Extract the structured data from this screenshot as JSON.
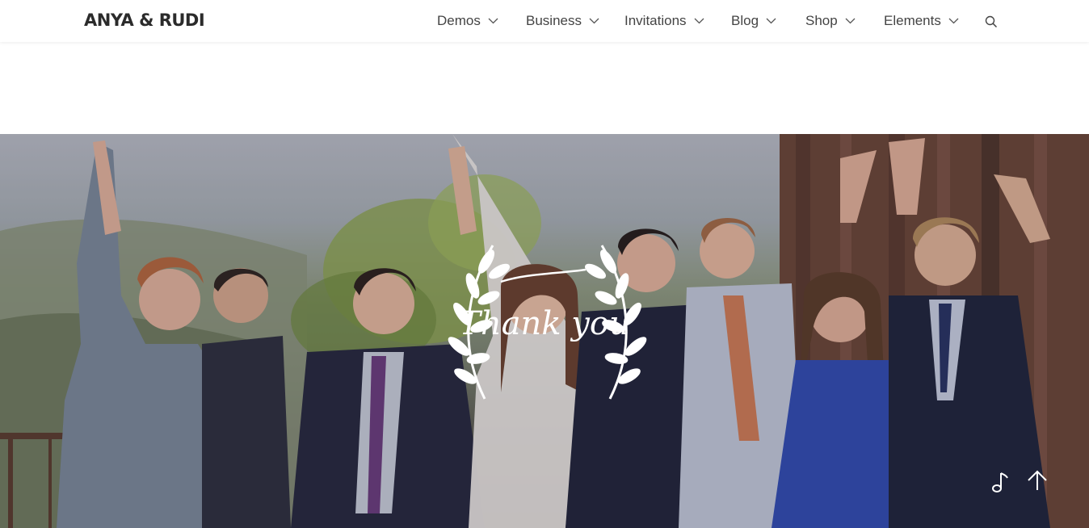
{
  "brand": {
    "logo_text": "ANYA & RUDI"
  },
  "nav": {
    "items": [
      {
        "label": "Demos"
      },
      {
        "label": "Business"
      },
      {
        "label": "Invitations"
      },
      {
        "label": "Blog"
      },
      {
        "label": "Shop"
      },
      {
        "label": "Elements"
      }
    ],
    "search_icon": "search-icon",
    "chevron_icon": "chevron-down-icon"
  },
  "hero": {
    "image": "group-photo-wedding-guests",
    "overlay_text": "Thank you",
    "overlay_color": "#ffffff"
  },
  "floating_buttons": {
    "music_icon": "music-note-icon",
    "back_to_top_icon": "arrow-up-icon"
  }
}
